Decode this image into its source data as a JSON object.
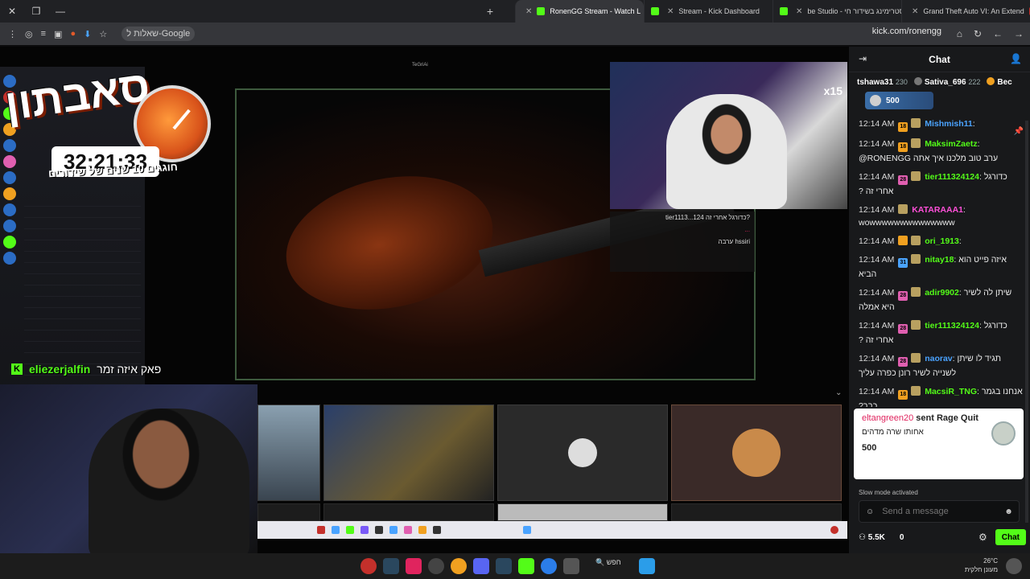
{
  "browser": {
    "tabs": [
      {
        "title": "Grand Theft Auto VI: An Extend",
        "color": "#c4302b"
      },
      {
        "title": "סטרימינג בשידור חי - be Studio",
        "color": "#c4302b"
      },
      {
        "title": "Stream - Kick Dashboard",
        "color": "#53fc18"
      },
      {
        "title": "RonenGG Stream - Watch L",
        "color": "#53fc18",
        "active": true
      }
    ],
    "new_tab": "+",
    "google_button": "שאלות ל-Google",
    "url": "kick.com/ronengg"
  },
  "stream": {
    "overlay_title": "סאבתון",
    "timer": "32:21:33",
    "subtitle": "חוגגים 10 שנים של שידורים",
    "multiplier": "x15",
    "small_label": "TeGriAi",
    "overlay_chat": [
      "?כדורגל אחרי זה tier1113...124",
      "...",
      "hssiri ערבה"
    ],
    "host_user": "eliezerjalfin",
    "host_msg": "פאק איזה זמר"
  },
  "chat": {
    "title": "Chat",
    "gifters": [
      {
        "name": "tshawa31",
        "count": "230"
      },
      {
        "name": "Sativa_696",
        "count": "222"
      },
      {
        "name": "Bec",
        "count": ""
      }
    ],
    "pinned_amount": "500",
    "messages": [
      {
        "time": "12:14 AM",
        "badge": "18",
        "badge_color": "#f0a020",
        "user": "Mishmish11",
        "user_color": "#4aa3ff",
        "text": ""
      },
      {
        "time": "12:14 AM",
        "badge": "18",
        "badge_color": "#f0a020",
        "user": "MaksimZaetz",
        "user_color": "#53fc18",
        "text": "@RONENGG ערב טוב מלכנו איך אתה"
      },
      {
        "time": "12:14 AM",
        "badge": "28",
        "badge_color": "#e05fb0",
        "user": "tier111324124",
        "user_color": "#53fc18",
        "text": "כדורגל אחרי זה ?"
      },
      {
        "time": "12:14 AM",
        "badge": "",
        "badge_color": "",
        "user": "KATARAAA1",
        "user_color": "#ff4fd8",
        "text": "wowwwwwwwwwwwwww"
      },
      {
        "time": "12:14 AM",
        "badge": "",
        "badge_color": "#f0a020",
        "user": "ori_1913",
        "user_color": "#53fc18",
        "text": ""
      },
      {
        "time": "12:14 AM",
        "badge": "31",
        "badge_color": "#4aa3ff",
        "user": "nitay18",
        "user_color": "#53fc18",
        "text": "איזה פייט הוא הביא"
      },
      {
        "time": "12:14 AM",
        "badge": "28",
        "badge_color": "#e05fb0",
        "user": "adir9902",
        "user_color": "#53fc18",
        "text": "שיתן לה לשיר היא אמלה"
      },
      {
        "time": "12:14 AM",
        "badge": "28",
        "badge_color": "#e05fb0",
        "user": "tier111324124",
        "user_color": "#53fc18",
        "text": "כדורגל אחרי זה ?"
      },
      {
        "time": "12:14 AM",
        "badge": "28",
        "badge_color": "#e05fb0",
        "user": "naorav",
        "user_color": "#4aa3ff",
        "text": "תגיד לו שיתן לשנייה לשיר רונן כפרה עליך"
      },
      {
        "time": "12:14 AM",
        "badge": "18",
        "badge_color": "#f0a020",
        "user": "MacsiR_TNG",
        "user_color": "#53fc18",
        "text": "אנחנו בגמר כבר?"
      }
    ],
    "gift": {
      "user": "eltangreen20",
      "action": "sent Rage Quit",
      "text": "אחותו שרה מדהים",
      "amount": "500"
    },
    "slow_mode": "Slow mode activated",
    "input_placeholder": "Send a message",
    "viewers": "5.5K",
    "count": "0",
    "chat_button": "Chat"
  },
  "taskbar": {
    "search": "חפש",
    "temp": "26°C",
    "weather": "מעונן חלקית"
  }
}
